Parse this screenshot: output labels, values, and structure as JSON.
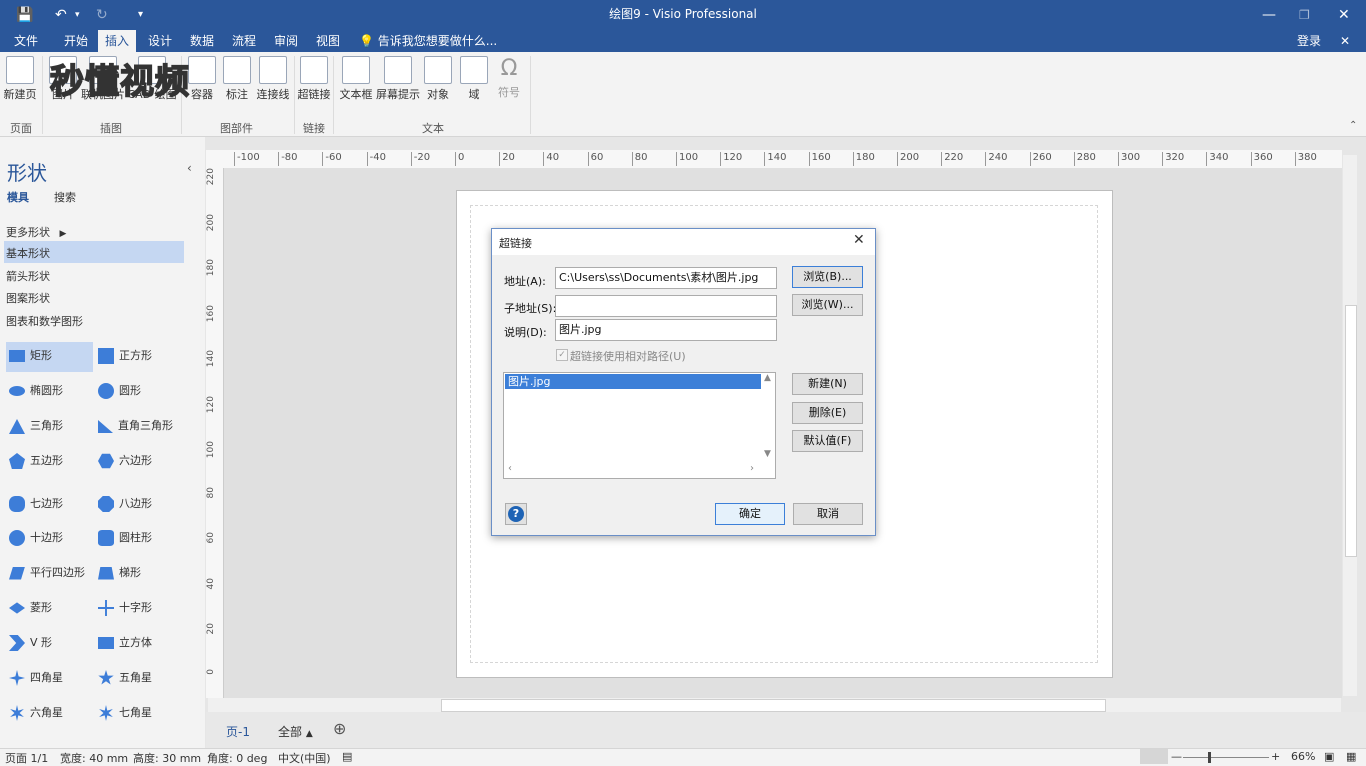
{
  "window": {
    "title": "绘图9 - Visio Professional",
    "login": "登录"
  },
  "tabs": [
    "文件",
    "开始",
    "插入",
    "设计",
    "数据",
    "流程",
    "审阅",
    "视图"
  ],
  "active_tab": "插入",
  "tellme": "告诉我您想要做什么...",
  "watermark": "秒懂视频",
  "ribbon": {
    "groups": [
      "页面",
      "插图",
      "图部件",
      "链接",
      "文本"
    ],
    "buttons": [
      "新建页",
      "图片",
      "联机图片",
      "CAD 绘图",
      "容器",
      "标注",
      "连接线",
      "超链接",
      "文本框",
      "屏幕提示",
      "对象",
      "域",
      "符号"
    ]
  },
  "shapes_pane": {
    "title": "形状",
    "tab_stencils": "模具",
    "tab_search": "搜索",
    "more_shapes": "更多形状",
    "stencils": [
      "基本形状",
      "箭头形状",
      "图案形状",
      "图表和数学图形"
    ],
    "shapes": [
      "矩形",
      "正方形",
      "椭圆形",
      "圆形",
      "三角形",
      "直角三角形",
      "五边形",
      "六边形",
      "七边形",
      "八边形",
      "十边形",
      "圆柱形",
      "平行四边形",
      "梯形",
      "菱形",
      "十字形",
      "V 形",
      "立方体",
      "四角星",
      "五角星",
      "六角星",
      "七角星"
    ]
  },
  "ruler_top": [
    "-100",
    "-80",
    "-60",
    "-40",
    "-20",
    "0",
    "20",
    "40",
    "60",
    "80",
    "100",
    "120",
    "140",
    "160",
    "180",
    "200",
    "220",
    "240",
    "260",
    "280",
    "300",
    "320",
    "340",
    "360",
    "380"
  ],
  "ruler_left": [
    "220",
    "200",
    "180",
    "160",
    "140",
    "120",
    "100",
    "80",
    "60",
    "40",
    "20",
    "0"
  ],
  "dialog": {
    "title": "超链接",
    "address_label": "地址(A):",
    "address_value": "C:\\Users\\ss\\Documents\\素材\\图片.jpg",
    "subaddress_label": "子地址(S):",
    "subaddress_value": "",
    "description_label": "说明(D):",
    "description_value": "图片.jpg",
    "relative_path": "超链接使用相对路径(U)",
    "browse_b": "浏览(B)...",
    "browse_w": "浏览(W)...",
    "list_items": [
      "图片.jpg"
    ],
    "new_btn": "新建(N)",
    "delete_btn": "删除(E)",
    "default_btn": "默认值(F)",
    "ok": "确定",
    "cancel": "取消"
  },
  "page_tabs": {
    "page": "页-1",
    "all": "全部"
  },
  "status": {
    "page": "页面 1/1",
    "width": "宽度: 40 mm",
    "height": "高度: 30 mm",
    "angle": "角度: 0 deg",
    "language": "中文(中国)",
    "zoom": "66%"
  }
}
